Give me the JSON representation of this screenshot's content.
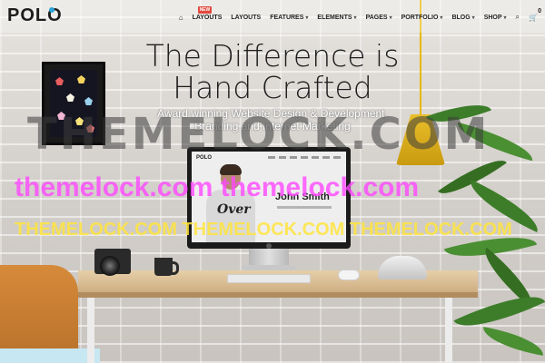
{
  "brand": {
    "name": "POLO",
    "accent": "#2aa3d6"
  },
  "nav": {
    "home_icon": "home-icon",
    "items": [
      {
        "label": "LAYOUTS",
        "badge": "NEW"
      },
      {
        "label": "LAYOUTS"
      },
      {
        "label": "FEATURES"
      },
      {
        "label": "ELEMENTS"
      },
      {
        "label": "PAGES"
      },
      {
        "label": "PORTFOLIO"
      },
      {
        "label": "BLOG"
      },
      {
        "label": "SHOP"
      }
    ],
    "search_icon": "search-icon",
    "cart_icon": "cart-icon",
    "cart_count": "0"
  },
  "hero": {
    "title_line1": "The Difference is",
    "title_line2": "Hand Crafted",
    "subtitle_line1": "Award winning Website Design & Development,",
    "subtitle_line2": "Branding and Internet Marketing"
  },
  "screen": {
    "logo": "POLO",
    "name": "John Smith",
    "shirt": "Over"
  },
  "watermarks": {
    "large": "THEMELOCK.COM",
    "pink": "themelock.com themelock.com",
    "yellow": "THEMELOCK.COM THEMELOCK.COM THEMELOCK.COM"
  },
  "colors": {
    "badge": "#e2483d",
    "lamp": "#e9be2a",
    "watermark_pink": "#ff46ff",
    "watermark_yellow": "#ffe43c"
  }
}
